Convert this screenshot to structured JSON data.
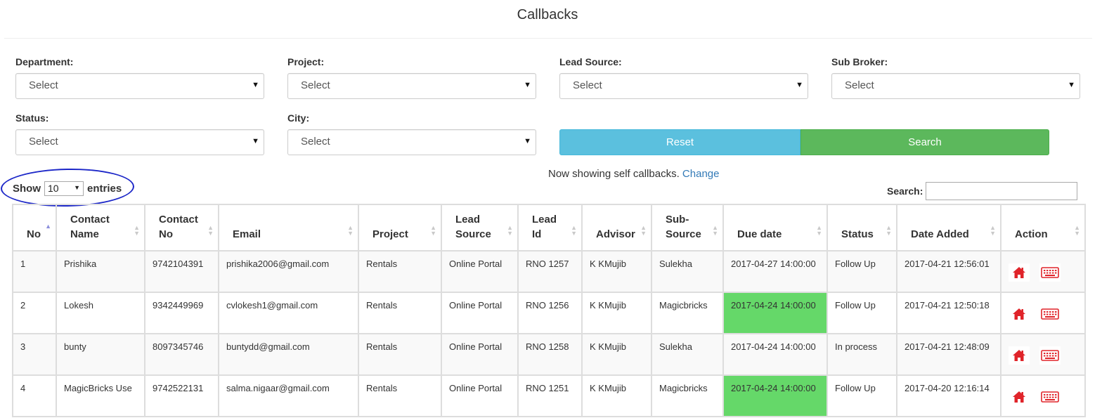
{
  "header": {
    "title": "Callbacks"
  },
  "filters": {
    "department": {
      "label": "Department:",
      "value": "Select"
    },
    "project": {
      "label": "Project:",
      "value": "Select"
    },
    "lead_source": {
      "label": "Lead Source:",
      "value": "Select"
    },
    "sub_broker": {
      "label": "Sub Broker:",
      "value": "Select"
    },
    "status": {
      "label": "Status:",
      "value": "Select"
    },
    "city": {
      "label": "City:",
      "value": "Select"
    },
    "reset_label": "Reset",
    "search_label": "Search"
  },
  "notice": {
    "text": "Now showing self callbacks.",
    "link": "Change"
  },
  "table_controls": {
    "show_label": "Show",
    "page_length": "10",
    "entries_label": "entries",
    "search_label": "Search:"
  },
  "colors": {
    "reset": "#5bc0de",
    "search": "#5cb85c",
    "due_highlight": "#65d869",
    "action_icon": "#e0242a",
    "annotation": "#1c27c8"
  },
  "table": {
    "columns": [
      [
        "No"
      ],
      [
        "Contact",
        "Name"
      ],
      [
        "Contact",
        "No"
      ],
      [
        "Email"
      ],
      [
        "Project"
      ],
      [
        "Lead",
        "Source"
      ],
      [
        "Lead",
        "Id"
      ],
      [
        "Advisor"
      ],
      [
        "Sub-",
        "Source"
      ],
      [
        "Due date"
      ],
      [
        "Status"
      ],
      [
        "Date Added"
      ],
      [
        "Action"
      ]
    ],
    "rows": [
      {
        "no": "1",
        "name": "Prishika",
        "phone": "9742104391",
        "email": "prishika2006@gmail.com",
        "project": "Rentals",
        "lead_source": "Online Portal",
        "lead_id": "RNO 1257",
        "advisor": "K KMujib",
        "sub_source": "Sulekha",
        "due": "2017-04-27 14:00:00",
        "status": "Follow Up",
        "added": "2017-04-21 12:56:01"
      },
      {
        "no": "2",
        "name": "Lokesh",
        "phone": "9342449969",
        "email": "cvlokesh1@gmail.com",
        "project": "Rentals",
        "lead_source": "Online Portal",
        "lead_id": "RNO 1256",
        "advisor": "K KMujib",
        "sub_source": "Magicbricks",
        "due": "2017-04-24 14:00:00",
        "status": "Follow Up",
        "added": "2017-04-21 12:50:18"
      },
      {
        "no": "3",
        "name": "bunty",
        "phone": "8097345746",
        "email": "buntydd@gmail.com",
        "project": "Rentals",
        "lead_source": "Online Portal",
        "lead_id": "RNO 1258",
        "advisor": "K KMujib",
        "sub_source": "Sulekha",
        "due": "2017-04-24 14:00:00",
        "status": "In process",
        "added": "2017-04-21 12:48:09"
      },
      {
        "no": "4",
        "name": "MagicBricks Use",
        "phone": "9742522131",
        "email": "salma.nigaar@gmail.com",
        "project": "Rentals",
        "lead_source": "Online Portal",
        "lead_id": "RNO 1251",
        "advisor": "K KMujib",
        "sub_source": "Magicbricks",
        "due": "2017-04-24 14:00:00",
        "status": "Follow Up",
        "added": "2017-04-20 12:16:14"
      }
    ]
  },
  "icons": {
    "sort": "sort-icon",
    "home": "home-icon",
    "keyboard": "keyboard-icon",
    "caret": "caret-down-icon"
  }
}
